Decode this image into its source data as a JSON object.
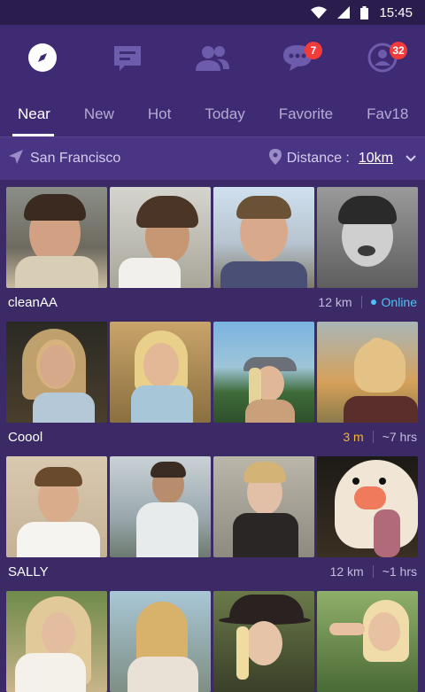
{
  "status_bar": {
    "time": "15:45"
  },
  "top_nav": {
    "items": [
      {
        "icon": "compass-icon"
      },
      {
        "icon": "chat-list-icon"
      },
      {
        "icon": "people-icon"
      },
      {
        "icon": "messages-icon",
        "badge": "7"
      },
      {
        "icon": "profile-icon",
        "badge": "32"
      }
    ]
  },
  "tabs": [
    "Near",
    "New",
    "Hot",
    "Today",
    "Favorite",
    "Fav18"
  ],
  "active_tab": "Near",
  "filter": {
    "location": "San Francisco",
    "distance_label": "Distance :",
    "distance_value": "10km"
  },
  "users": [
    {
      "name": "cleanAA",
      "distance": "12 km",
      "status": "Online"
    },
    {
      "name": "Coool",
      "distance": "3 m",
      "status": "~7 hrs"
    },
    {
      "name": "SALLY",
      "distance": "12 km",
      "status": "~1 hrs"
    }
  ],
  "colors": {
    "background": "#3b2a66",
    "nav": "#3f2b73",
    "badge": "#f23b3b",
    "online": "#4cc3f5",
    "near_distance": "#f4b43a"
  }
}
